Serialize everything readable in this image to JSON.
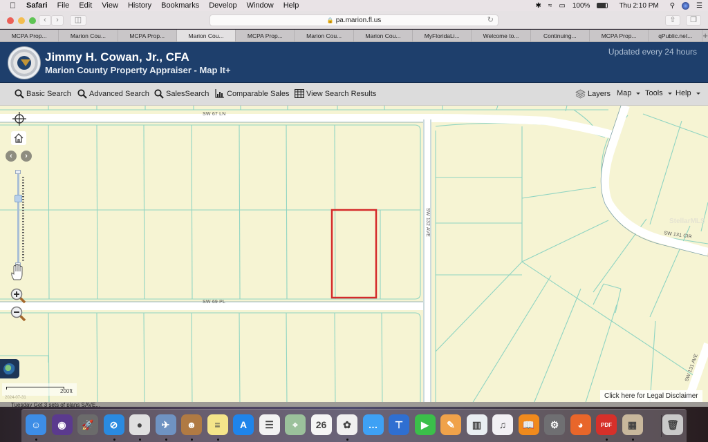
{
  "menubar": {
    "app": "Safari",
    "items": [
      "File",
      "Edit",
      "View",
      "History",
      "Bookmarks",
      "Develop",
      "Window",
      "Help"
    ],
    "battery": "100%",
    "clock": "Thu 2:10 PM"
  },
  "browser": {
    "url": "pa.marion.fl.us",
    "tabs": [
      {
        "label": "MCPA Prop...",
        "active": false
      },
      {
        "label": "Marion Cou...",
        "active": false
      },
      {
        "label": "MCPA Prop...",
        "active": false
      },
      {
        "label": "Marion Cou...",
        "active": true
      },
      {
        "label": "MCPA Prop...",
        "active": false
      },
      {
        "label": "Marion Cou...",
        "active": false
      },
      {
        "label": "Marion Cou...",
        "active": false
      },
      {
        "label": "MyFloridaLi...",
        "active": false
      },
      {
        "label": "Welcome to...",
        "active": false
      },
      {
        "label": "Continuing...",
        "active": false
      },
      {
        "label": "MCPA Prop...",
        "active": false
      },
      {
        "label": "qPublic.net...",
        "active": false
      }
    ],
    "new_tab": "+"
  },
  "header": {
    "title": "Jimmy H. Cowan, Jr., CFA",
    "subtitle": "Marion County Property Appraiser - Map It+",
    "updated": "Updated every 24 hours"
  },
  "nav": {
    "basic_search": "Basic Search",
    "advanced_search": "Advanced Search",
    "sales_search": "SalesSearch",
    "comparable_sales": "Comparable Sales",
    "view_results": "View Search Results",
    "layers": "Layers",
    "map": "Map",
    "tools": "Tools",
    "help": "Help"
  },
  "map": {
    "roads": {
      "sw67ln": "SW 67 LN",
      "sw69pl": "SW 69 PL",
      "sw132ave": "SW 132 AVE",
      "sw131cir": "SW 131 CIR",
      "sw131ave": "SW 131 AVE"
    },
    "watermark": "StellarMLS",
    "scale_label": "200ft",
    "date_stamp": "2024-07-31",
    "legal_disclaimer": "Click here for Legal Disclaimer",
    "zoom_level_fraction": 0.25,
    "highlight_color": "#d42a2a",
    "parcel_line_color": "#8fd4c2",
    "nav_back": "‹",
    "nav_forward": "›"
  },
  "ticker": "Tuesday   Get 3 sets of plans SAVE...",
  "dock": {
    "apps": [
      {
        "name": "Finder",
        "glyph": "☺",
        "color": "#3d8de6",
        "running": true
      },
      {
        "name": "Siri",
        "glyph": "◉",
        "color": "#5b3a8e",
        "running": false
      },
      {
        "name": "Launchpad",
        "glyph": "🚀",
        "color": "#6b6b6b",
        "running": false
      },
      {
        "name": "Safari",
        "glyph": "⊘",
        "color": "#2a8ae0",
        "running": true
      },
      {
        "name": "Chrome",
        "glyph": "●",
        "color": "#e0e0e0",
        "running": true
      },
      {
        "name": "Preview",
        "glyph": "✈",
        "color": "#6f93c2",
        "running": true
      },
      {
        "name": "Contacts",
        "glyph": "☻",
        "color": "#b07a43",
        "running": true
      },
      {
        "name": "Notes",
        "glyph": "≡",
        "color": "#f5e58a",
        "running": true
      },
      {
        "name": "App Store",
        "glyph": "A",
        "color": "#1f84ea",
        "running": false
      },
      {
        "name": "Reminders",
        "glyph": "☰",
        "color": "#f2f2f2",
        "running": false
      },
      {
        "name": "Maps",
        "glyph": "⌖",
        "color": "#9bc19b",
        "running": false
      },
      {
        "name": "Calendar",
        "glyph": "26",
        "color": "#f5f5f5",
        "running": false
      },
      {
        "name": "Photos",
        "glyph": "✿",
        "color": "#f0f0f0",
        "running": true
      },
      {
        "name": "Messages",
        "glyph": "…",
        "color": "#3ea1f5",
        "running": false
      },
      {
        "name": "Keynote",
        "glyph": "⊤",
        "color": "#2f6fd1",
        "running": false
      },
      {
        "name": "FaceTime",
        "glyph": "▶",
        "color": "#3bbf4a",
        "running": false
      },
      {
        "name": "Pages",
        "glyph": "✎",
        "color": "#f0a24a",
        "running": false
      },
      {
        "name": "Numbers",
        "glyph": "▥",
        "color": "#e9eef2",
        "running": false
      },
      {
        "name": "iTunes",
        "glyph": "♫",
        "color": "#f2f0f4",
        "running": false
      },
      {
        "name": "iBooks",
        "glyph": "📖",
        "color": "#f08a1c",
        "running": false
      },
      {
        "name": "System Preferences",
        "glyph": "⚙",
        "color": "#6f6f72",
        "running": false
      },
      {
        "name": "Firefox",
        "glyph": "◕",
        "color": "#e8662a",
        "running": false
      },
      {
        "name": "PDF Expert",
        "glyph": "PDF",
        "color": "#d6302a",
        "running": true
      },
      {
        "name": "Table Tool",
        "glyph": "▦",
        "color": "#c8b79c",
        "running": true
      },
      {
        "name": "Trash",
        "glyph": "🗑",
        "color": "#c9c9c9",
        "running": false
      }
    ]
  }
}
